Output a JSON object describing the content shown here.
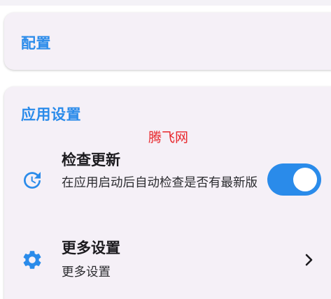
{
  "config_section": {
    "title": "配置"
  },
  "app_settings": {
    "title": "应用设置",
    "watermark": "腾飞网",
    "check_update": {
      "icon": "update-clock-icon",
      "title": "检查更新",
      "subtitle": "在应用启动后自动检查是否有最新版",
      "toggle_on": true
    },
    "more_settings": {
      "icon": "gear-icon",
      "title": "更多设置",
      "subtitle": "更多设置",
      "trailing_icon": "chevron-right-icon"
    }
  },
  "colors": {
    "accent": "#2a8bea",
    "card_background": "#f5f0f7",
    "watermark": "#e8262b"
  }
}
